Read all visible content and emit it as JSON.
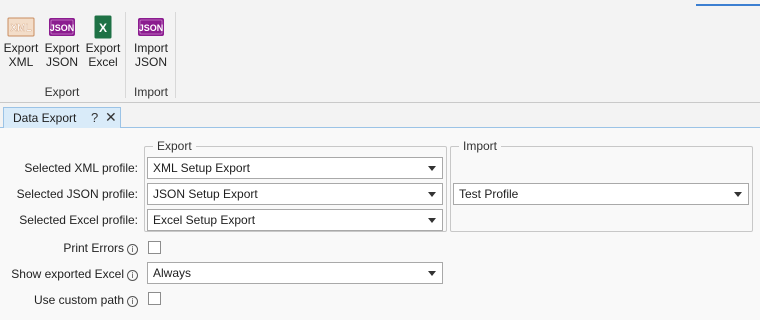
{
  "ribbon": {
    "export_group": {
      "label": "Export",
      "buttons": [
        {
          "icon": "xml-file-icon",
          "icon_text": "XML",
          "line1": "Export",
          "line2": "XML"
        },
        {
          "icon": "json-file-icon",
          "icon_text": "JSON",
          "line1": "Export",
          "line2": "JSON"
        },
        {
          "icon": "excel-file-icon",
          "icon_text": "X",
          "line1": "Export",
          "line2": "Excel"
        }
      ]
    },
    "import_group": {
      "label": "Import",
      "buttons": [
        {
          "icon": "json-file-icon",
          "icon_text": "JSON",
          "line1": "Import",
          "line2": "JSON"
        }
      ]
    }
  },
  "tab": {
    "title": "Data Export",
    "help": "?",
    "close": "✕"
  },
  "export_section": {
    "legend": "Export",
    "rows": [
      {
        "label": "Selected XML profile:",
        "value": "XML Setup Export"
      },
      {
        "label": "Selected JSON profile:",
        "value": "JSON Setup Export"
      },
      {
        "label": "Selected Excel profile:",
        "value": "Excel Setup Export"
      }
    ]
  },
  "import_section": {
    "legend": "Import",
    "json_profile_value": "Test Profile"
  },
  "options": {
    "print_errors_label": "Print Errors",
    "print_errors_checked": false,
    "show_excel_label": "Show exported Excel",
    "show_excel_value": "Always",
    "custom_path_label": "Use custom path",
    "custom_path_checked": false,
    "info_glyph": "i"
  },
  "colors": {
    "xml_icon": "#d9a37a",
    "json_icon": "#8b1c8f",
    "excel_icon": "#1e7145",
    "tab_active": "#d9ebf9",
    "accent": "#3c7fd1"
  }
}
